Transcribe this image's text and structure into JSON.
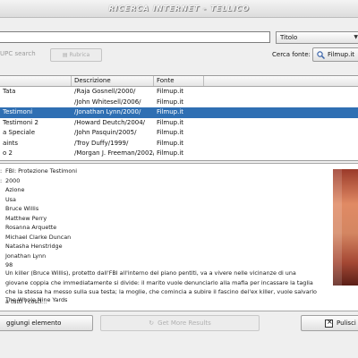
{
  "window": {
    "title": "RICERCA INTERNET - TELLICO"
  },
  "search": {
    "value": "",
    "type_selected": "Titolo",
    "upc_label": "UPC search",
    "upc_button": "Rubrica"
  },
  "sources": {
    "label": "Cerca fonte:",
    "selected": "Filmup.it"
  },
  "results": {
    "columns": [
      "",
      "Descrizione",
      "Fonte",
      ""
    ],
    "rows": [
      {
        "title": "Tata",
        "desc": "/Raja Gosnell/2000/",
        "source": "Filmup.it",
        "selected": false
      },
      {
        "title": "",
        "desc": "/John Whitesell/2006/",
        "source": "Filmup.it",
        "selected": false
      },
      {
        "title": "Testimoni",
        "desc": "/Jonathan Lynn/2000/",
        "source": "Filmup.it",
        "selected": true
      },
      {
        "title": "Testimoni 2",
        "desc": "/Howard Deutch/2004/",
        "source": "Filmup.it",
        "selected": false
      },
      {
        "title": "a Speciale",
        "desc": "/John Pasquin/2005/",
        "source": "Filmup.it",
        "selected": false
      },
      {
        "title": "aints",
        "desc": "/Troy Duffy/1999/",
        "source": "Filmup.it",
        "selected": false
      },
      {
        "title": "o 2",
        "desc": "/Morgan J. Freeman/2002/",
        "source": "Filmup.it",
        "selected": false
      }
    ]
  },
  "detail": {
    "title": "FBI: Protezione Testimoni",
    "title_prefix": ":",
    "year": "2000",
    "year_prefix": ":",
    "genre": "Azione",
    "country": "Usa",
    "cast": [
      "Bruce Willis",
      "Matthew Perry",
      "Rosanna Arquette",
      "Michael Clarke Duncan",
      "Natasha Henstridge"
    ],
    "director": "Jonathan Lynn",
    "runtime": "98",
    "plot": "Un killer (Bruce Willis), protetto dall'FBI all'interno del piano pentiti, va a vivere nelle vicinanze di una giovane coppia che immediatamente si divide: il marito vuole denunciarlo alla mafia per incassare la taglia che la stessa ha messo sulla sua testa; la moglie, che comincia a subire il fascino del'ex killer, vuole salvarlo a tutti i costi...",
    "original_title": "The Whole Nine Yards"
  },
  "buttons": {
    "add": "ggiungi elemento",
    "lookup": "Get More Results",
    "clear": "Pulisci"
  }
}
